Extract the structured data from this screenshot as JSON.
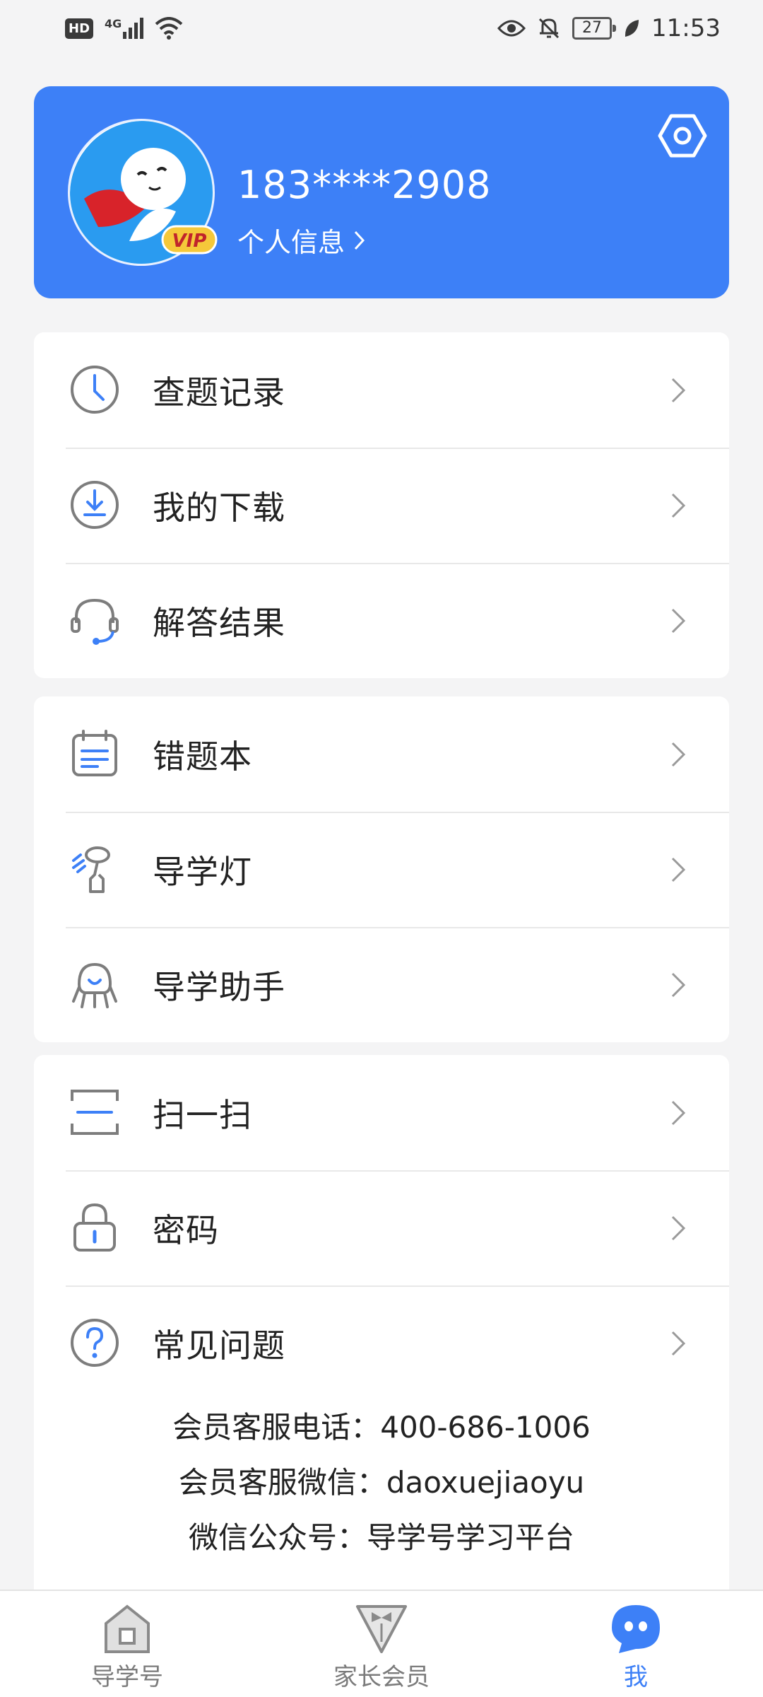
{
  "status_bar": {
    "hd": "HD",
    "network": "4G",
    "battery": "27",
    "time": "11:53"
  },
  "profile": {
    "avatar_badge": "VIP",
    "phone": "183****2908",
    "info_link": "个人信息"
  },
  "menu": {
    "group1": [
      {
        "label": "查题记录",
        "icon": "clock-icon"
      },
      {
        "label": "我的下载",
        "icon": "download-icon"
      },
      {
        "label": "解答结果",
        "icon": "headset-icon"
      }
    ],
    "group2": [
      {
        "label": "错题本",
        "icon": "notebook-icon"
      },
      {
        "label": "导学灯",
        "icon": "lamp-icon"
      },
      {
        "label": "导学助手",
        "icon": "assistant-icon"
      }
    ],
    "group3": [
      {
        "label": "扫一扫",
        "icon": "scan-icon"
      },
      {
        "label": "密码",
        "icon": "lock-icon"
      },
      {
        "label": "常见问题",
        "icon": "question-icon"
      }
    ]
  },
  "contact": {
    "phone_line": "会员客服电话：400-686-1006",
    "wechat_line": "会员客服微信：daoxuejiaoyu",
    "account_line": "微信公众号：导学号学习平台"
  },
  "bottom_nav": [
    {
      "label": "导学号",
      "active": false
    },
    {
      "label": "家长会员",
      "active": false
    },
    {
      "label": "我",
      "active": true
    }
  ],
  "colors": {
    "accent": "#3d80f7",
    "background": "#f4f4f5",
    "icon_gray": "#7d7d7d"
  }
}
